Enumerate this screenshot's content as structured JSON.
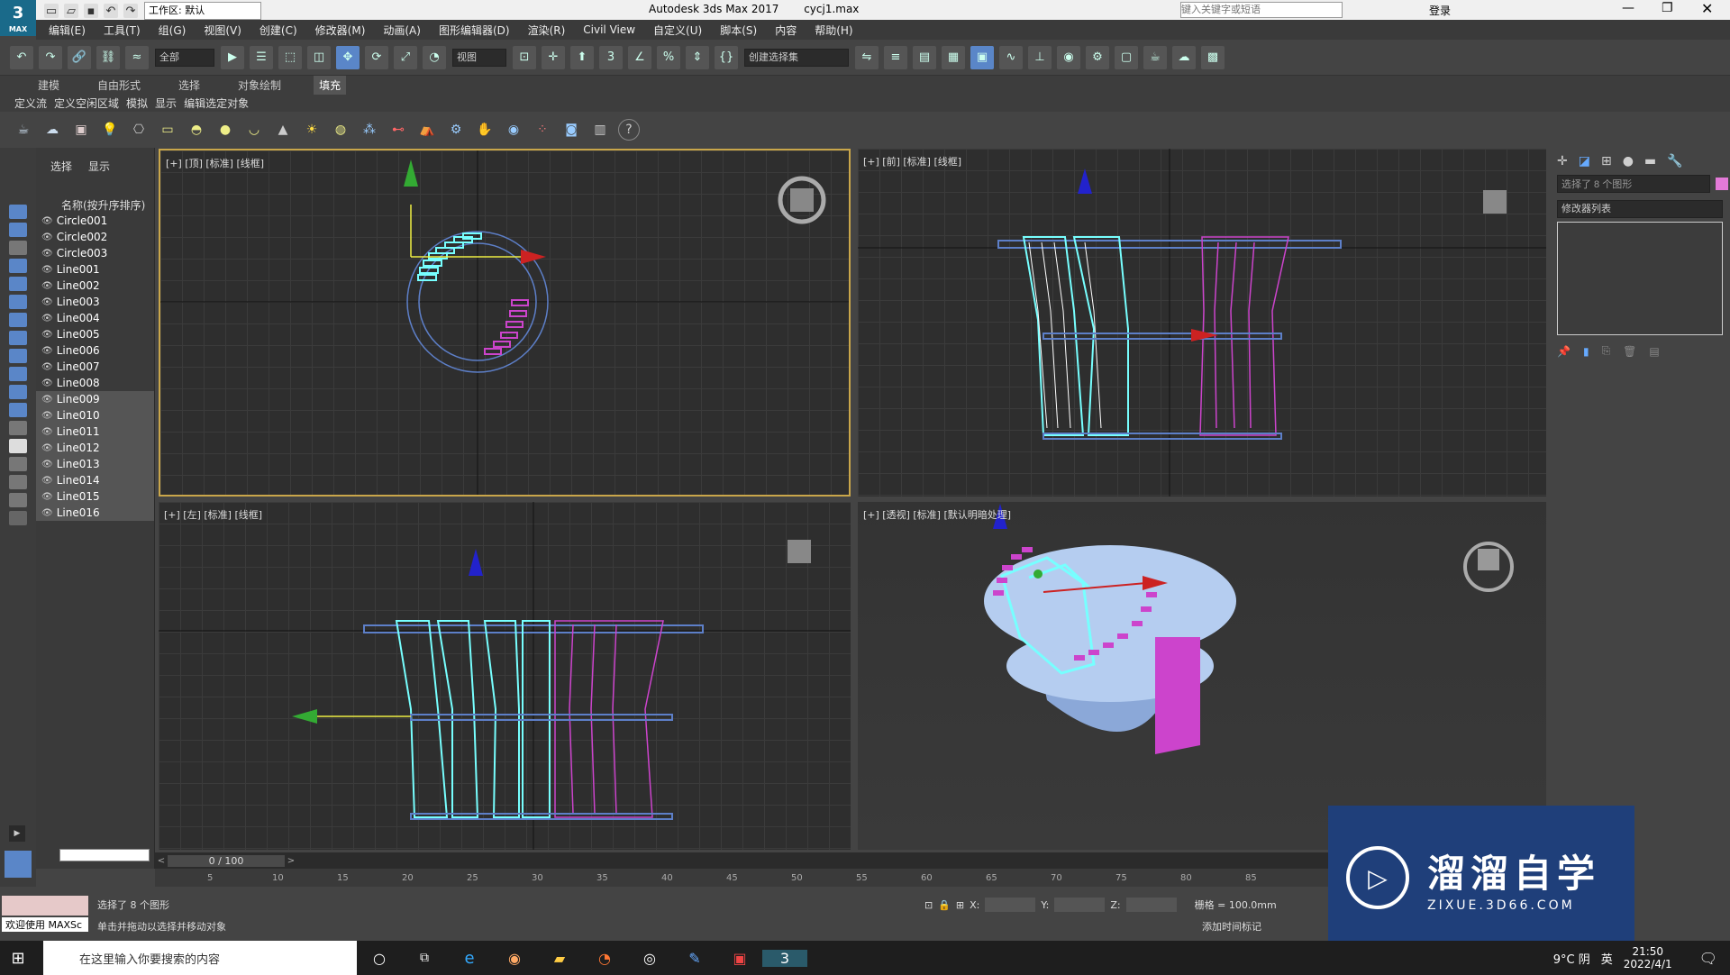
{
  "window": {
    "title": "Autodesk 3ds Max 2017",
    "file": "cycj1.max",
    "workspace": "工作区: 默认",
    "search_placeholder": "键入关键字或短语",
    "login": "登录"
  },
  "menu": [
    "编辑(E)",
    "工具(T)",
    "组(G)",
    "视图(V)",
    "创建(C)",
    "修改器(M)",
    "动画(A)",
    "图形编辑器(D)",
    "渲染(R)",
    "Civil View",
    "自定义(U)",
    "脚本(S)",
    "内容",
    "帮助(H)"
  ],
  "toolbar": {
    "filter": "全部",
    "view": "视图",
    "selection_set": "创建选择集"
  },
  "ribbon": {
    "tabs": [
      "建模",
      "自由形式",
      "选择",
      "对象绘制",
      "填充"
    ],
    "active_tab": "填充",
    "sub": [
      "定义流",
      "定义空闲区域",
      "模拟",
      "显示",
      "编辑选定对象"
    ]
  },
  "scene_explorer": {
    "tabs": [
      "选择",
      "显示"
    ],
    "header": "名称(按升序排序)",
    "items": [
      "Circle001",
      "Circle002",
      "Circle003",
      "Line001",
      "Line002",
      "Line003",
      "Line004",
      "Line005",
      "Line006",
      "Line007",
      "Line008",
      "Line009",
      "Line010",
      "Line011",
      "Line012",
      "Line013",
      "Line014",
      "Line015",
      "Line016"
    ]
  },
  "viewports": {
    "top": "[+] [顶] [标准] [线框]",
    "front": "[+] [前] [标准] [线框]",
    "left": "[+] [左] [标准] [线框]",
    "persp": "[+] [透视] [标准] [默认明暗处理]"
  },
  "command_panel": {
    "selection": "选择了 8 个图形",
    "modifier_list": "修改器列表"
  },
  "timeline": {
    "frame": "0 / 100",
    "ticks": [
      "5",
      "10",
      "15",
      "20",
      "25",
      "30",
      "35",
      "40",
      "45",
      "50",
      "55",
      "60",
      "65",
      "70",
      "75",
      "80",
      "85"
    ]
  },
  "status": {
    "welcome": "欢迎使用 MAXSc",
    "selected": "选择了 8 个图形",
    "hint": "单击并拖动以选择并移动对象",
    "x": "X:",
    "y": "Y:",
    "z": "Z:",
    "grid": "栅格 = 100.0mm",
    "add_tag": "添加时间标记"
  },
  "taskbar": {
    "search": "在这里输入你要搜索的内容",
    "weather": "9°C 阴",
    "lang": "英",
    "time": "21:50",
    "date": "2022/4/1"
  },
  "watermark": {
    "brand": "溜溜自学",
    "url": "ZIXUE.3D66.COM"
  }
}
